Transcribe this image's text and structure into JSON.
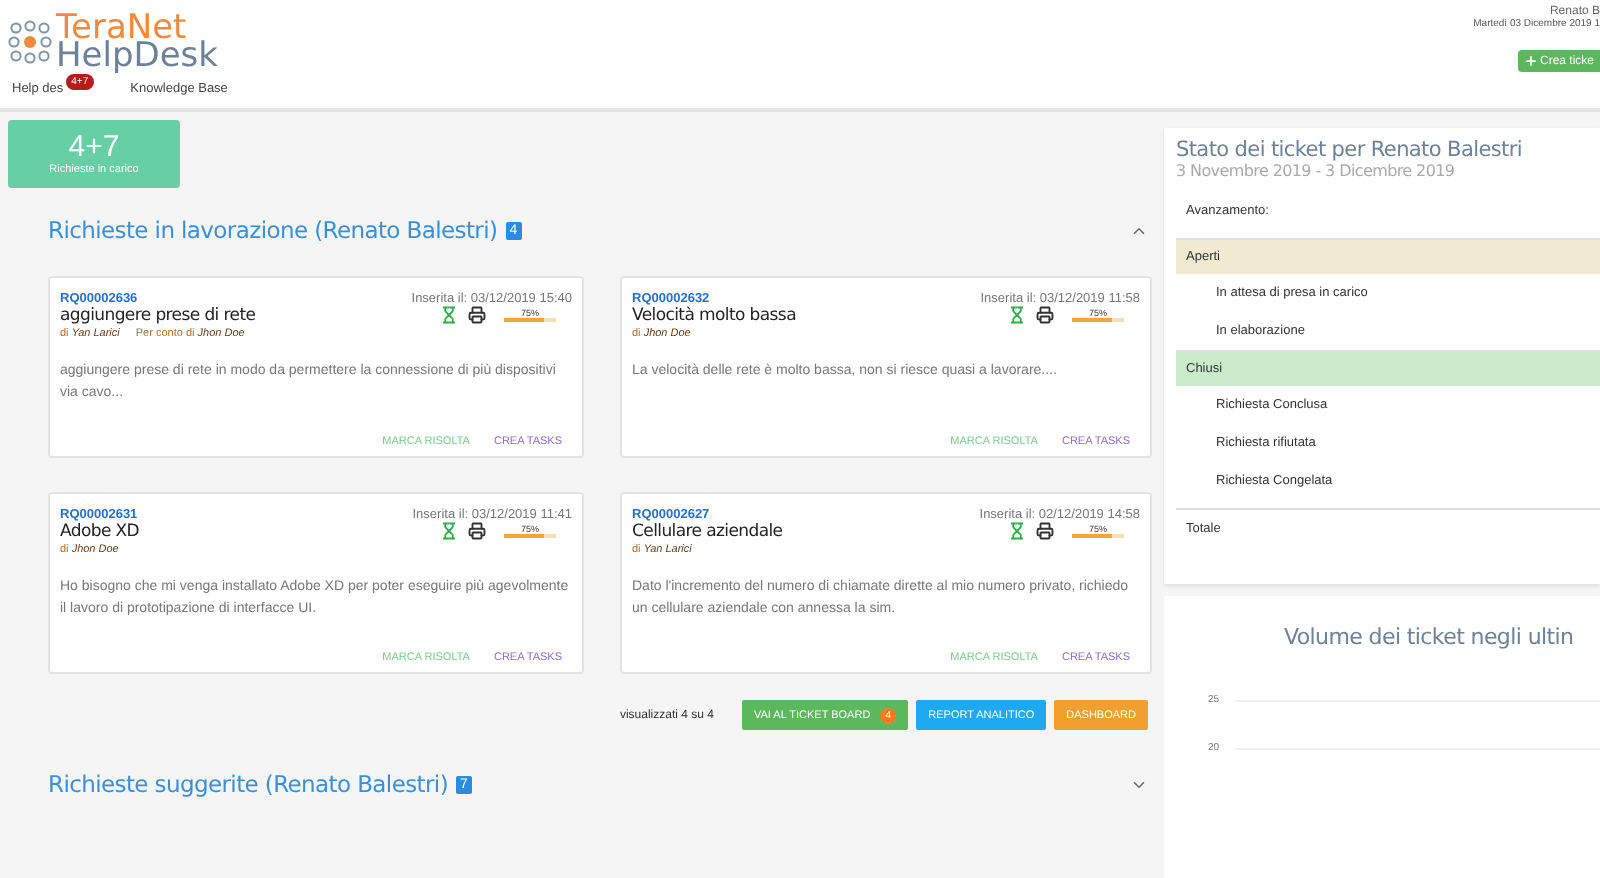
{
  "header": {
    "logo_top": "TeraNet",
    "logo_bottom": "HelpDesk",
    "user": "Renato B",
    "date": "Martedì 03 Dicembre 2019 1",
    "new_ticket": "Crea ticke"
  },
  "nav": [
    {
      "label": "Help des",
      "badge": "4+7",
      "selected": false
    },
    {
      "label": "Knowledge Base",
      "selected": false
    }
  ],
  "stat": {
    "value": "4+7",
    "label": "Richieste in carico"
  },
  "working": {
    "title": "Richieste in lavorazione (Renato Balestri)",
    "count": "4",
    "expanded": true,
    "cards": [
      {
        "id": "RQ00002636",
        "inserted": "Inserita il: 03/12/2019 15:40",
        "title": "aggiungere prese di rete",
        "by_label": "di",
        "by_name": "Yan Larici",
        "behalf_label": "Per conto di",
        "behalf_name": "Jhon Doe",
        "progress": "75%",
        "level": 0.75,
        "description": "aggiungere prese di rete in modo da permettere la connessione di più dispositivi via cavo...",
        "actions": [
          "MARCA RISOLTA",
          "CREA TASKS"
        ]
      },
      {
        "id": "RQ00002632",
        "inserted": "Inserita il: 03/12/2019 11:58",
        "title": "Velocità molto bassa",
        "by_label": "di",
        "by_name": "Jhon Doe",
        "progress": "75%",
        "level": 0.75,
        "description": "La velocità delle rete è molto bassa, non si riesce quasi a lavorare....",
        "actions": [
          "MARCA RISOLTA",
          "CREA TASKS"
        ]
      },
      {
        "id": "RQ00002631",
        "inserted": "Inserita il: 03/12/2019 11:41",
        "title": "Adobe XD",
        "by_label": "di",
        "by_name": "Jhon Doe",
        "progress": "75%",
        "level": 0.75,
        "description": "Ho bisogno che mi venga installato Adobe XD per poter eseguire più agevolmente il lavoro di prototipazione di interfacce UI.",
        "actions": [
          "MARCA RISOLTA",
          "CREA TASKS"
        ]
      },
      {
        "id": "RQ00002627",
        "inserted": "Inserita il: 02/12/2019 14:58",
        "title": "Cellulare aziendale",
        "by_label": "di",
        "by_name": "Yan Larici",
        "progress": "75%",
        "level": 0.75,
        "description": "Dato l'incremento del numero di chiamate dirette al mio numero privato, richiedo un cellulare aziendale con annessa la sim.",
        "actions": [
          "MARCA RISOLTA",
          "CREA TASKS"
        ]
      }
    ],
    "shown": "visualizzati 4 su 4",
    "buttons": [
      {
        "label": "VAI AL TICKET BOARD",
        "badge": "4",
        "color": "#5cb85c"
      },
      {
        "label": "REPORT ANALITICO",
        "color": "#1eaaf1"
      },
      {
        "label": "DASHBOARD",
        "color": "#f0a030"
      }
    ]
  },
  "suggested": {
    "title": "Richieste suggerite (Renato Balestri)",
    "count": "7",
    "expanded": false
  },
  "status_panel": {
    "title": "Stato dei ticket per Renato Balestri",
    "period": "3 Novembre 2019 - 3 Dicembre 2019",
    "progress_label": "Avanzamento:",
    "groups": [
      {
        "label": "Aperti",
        "color": "#f0ead2",
        "items": [
          "In attesa di presa in carico",
          "In elaborazione"
        ]
      },
      {
        "label": "Chiusi",
        "color": "#c9ebc9",
        "items": [
          "Richiesta Conclusa",
          "Richiesta rifiutata",
          "Richiesta Congelata"
        ]
      }
    ],
    "total": "Totale"
  },
  "volume_chart": {
    "title": "Volume dei ticket negli ultin",
    "tick_labels": [
      "25",
      "20"
    ]
  }
}
